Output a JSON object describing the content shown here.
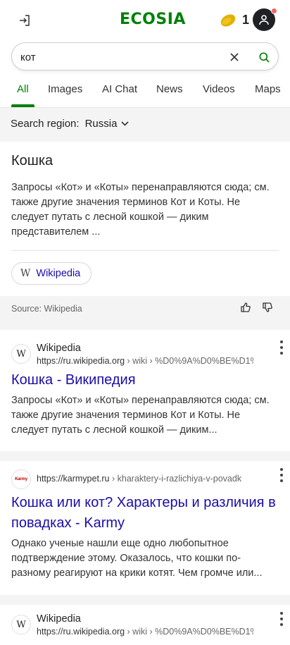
{
  "header": {
    "logo": "ECOSIA",
    "seed_count": "1",
    "colors": {
      "brand": "#008009",
      "link": "#1a0dab",
      "notification": "#e8696b"
    }
  },
  "search": {
    "query": "кот",
    "placeholder": ""
  },
  "tabs": [
    {
      "label": "All",
      "active": true
    },
    {
      "label": "Images"
    },
    {
      "label": "AI Chat"
    },
    {
      "label": "News"
    },
    {
      "label": "Videos"
    },
    {
      "label": "Maps"
    }
  ],
  "region": {
    "label": "Search region:",
    "value": "Russia"
  },
  "knowledge_panel": {
    "title": "Кошка",
    "description": "Запросы «Кот» и «Коты» перенаправляются сюда; см. также другие значения терминов Кот и Коты. Не следует путать с лесной кошкой — диким представителем ...",
    "chip_label": "Wikipedia",
    "source": "Source: Wikipedia"
  },
  "results": [
    {
      "site_name": "Wikipedia",
      "url_host": "https://ru.wikipedia.org",
      "url_path": " › wiki › %D0%9A%D0%BE%D1%",
      "title": "Кошка - Википедия",
      "snippet": "Запросы «Кот» и «Коты» перенаправляются сюда; см. также другие значения терминов Кот и Коты. Не следует путать с лесной кошкой — диким..."
    },
    {
      "favicon_text": "Karmy",
      "url_host": "https://karmypet.ru",
      "url_path": " › kharaktery-i-razlichiya-v-povadk",
      "title": "Кошка или кот? Характеры и различия в повадках - Karmy",
      "snippet": "Однако ученые нашли еще одно любопытное подтверждение этому. Оказалось, что кошки по-разному реагируют на крики котят. Чем громче или..."
    },
    {
      "site_name": "Wikipedia",
      "url_host": "https://ru.wikipedia.org",
      "url_path": " › wiki › %D0%9A%D0%BE%D1%"
    }
  ]
}
